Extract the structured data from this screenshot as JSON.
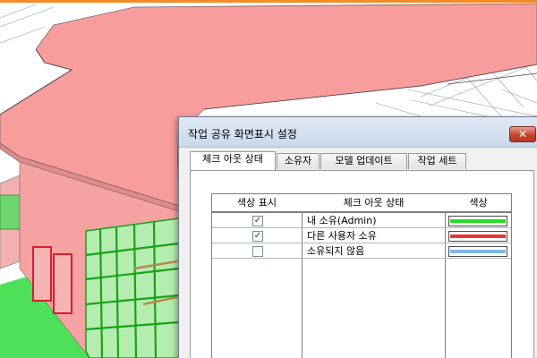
{
  "dialog": {
    "title": "작업 공유 화면표시 설정",
    "close_label": "✕",
    "tabs": [
      {
        "label": "체크 아웃 상태",
        "active": true
      },
      {
        "label": "소유자",
        "active": false
      },
      {
        "label": "모델 업데이트",
        "active": false
      },
      {
        "label": "작업 세트",
        "active": false
      }
    ],
    "table": {
      "headers": [
        "색상 표시",
        "체크 아웃 상태",
        "색상"
      ],
      "rows": [
        {
          "checked": true,
          "check_mark": "✓",
          "label": "내 소유(Admin)",
          "color": "#22dd22"
        },
        {
          "checked": true,
          "check_mark": "✓",
          "label": "다른 사용자 소유",
          "color": "#ee3333"
        },
        {
          "checked": false,
          "check_mark": "",
          "label": "소유되지 않음",
          "color": "#7fb7e8"
        }
      ]
    }
  },
  "colors": {
    "accent": "#f28c28",
    "roof": "#f89d9d",
    "walls": "#f5a2a2",
    "glazing_green": "#3ccf3c",
    "dialog_titlebar": "#d3e1f2",
    "close_button": "#c7432b"
  }
}
